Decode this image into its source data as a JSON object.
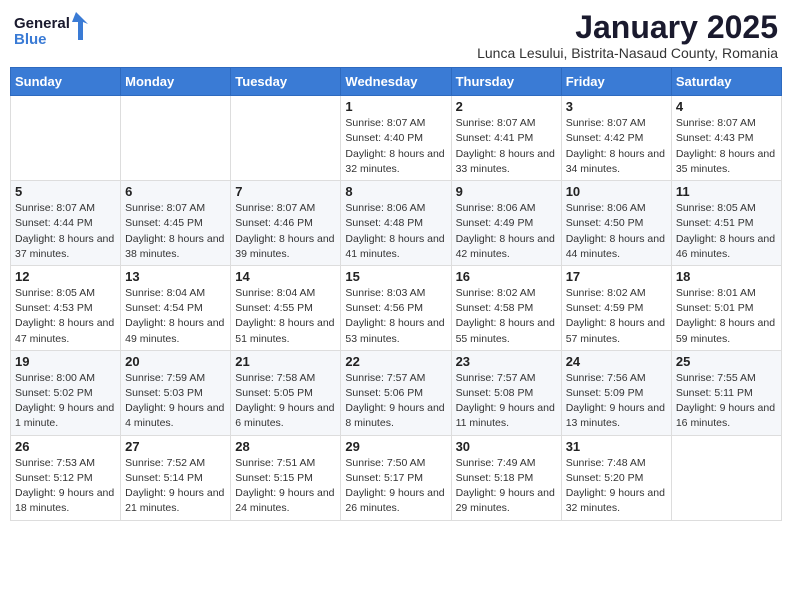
{
  "logo": {
    "general": "General",
    "blue": "Blue",
    "arrow_color": "#3a7bd5"
  },
  "header": {
    "month": "January 2025",
    "location": "Lunca Lesului, Bistrita-Nasaud County, Romania"
  },
  "weekdays": [
    "Sunday",
    "Monday",
    "Tuesday",
    "Wednesday",
    "Thursday",
    "Friday",
    "Saturday"
  ],
  "weeks": [
    [
      {
        "day": "",
        "info": ""
      },
      {
        "day": "",
        "info": ""
      },
      {
        "day": "",
        "info": ""
      },
      {
        "day": "1",
        "info": "Sunrise: 8:07 AM\nSunset: 4:40 PM\nDaylight: 8 hours and 32 minutes."
      },
      {
        "day": "2",
        "info": "Sunrise: 8:07 AM\nSunset: 4:41 PM\nDaylight: 8 hours and 33 minutes."
      },
      {
        "day": "3",
        "info": "Sunrise: 8:07 AM\nSunset: 4:42 PM\nDaylight: 8 hours and 34 minutes."
      },
      {
        "day": "4",
        "info": "Sunrise: 8:07 AM\nSunset: 4:43 PM\nDaylight: 8 hours and 35 minutes."
      }
    ],
    [
      {
        "day": "5",
        "info": "Sunrise: 8:07 AM\nSunset: 4:44 PM\nDaylight: 8 hours and 37 minutes."
      },
      {
        "day": "6",
        "info": "Sunrise: 8:07 AM\nSunset: 4:45 PM\nDaylight: 8 hours and 38 minutes."
      },
      {
        "day": "7",
        "info": "Sunrise: 8:07 AM\nSunset: 4:46 PM\nDaylight: 8 hours and 39 minutes."
      },
      {
        "day": "8",
        "info": "Sunrise: 8:06 AM\nSunset: 4:48 PM\nDaylight: 8 hours and 41 minutes."
      },
      {
        "day": "9",
        "info": "Sunrise: 8:06 AM\nSunset: 4:49 PM\nDaylight: 8 hours and 42 minutes."
      },
      {
        "day": "10",
        "info": "Sunrise: 8:06 AM\nSunset: 4:50 PM\nDaylight: 8 hours and 44 minutes."
      },
      {
        "day": "11",
        "info": "Sunrise: 8:05 AM\nSunset: 4:51 PM\nDaylight: 8 hours and 46 minutes."
      }
    ],
    [
      {
        "day": "12",
        "info": "Sunrise: 8:05 AM\nSunset: 4:53 PM\nDaylight: 8 hours and 47 minutes."
      },
      {
        "day": "13",
        "info": "Sunrise: 8:04 AM\nSunset: 4:54 PM\nDaylight: 8 hours and 49 minutes."
      },
      {
        "day": "14",
        "info": "Sunrise: 8:04 AM\nSunset: 4:55 PM\nDaylight: 8 hours and 51 minutes."
      },
      {
        "day": "15",
        "info": "Sunrise: 8:03 AM\nSunset: 4:56 PM\nDaylight: 8 hours and 53 minutes."
      },
      {
        "day": "16",
        "info": "Sunrise: 8:02 AM\nSunset: 4:58 PM\nDaylight: 8 hours and 55 minutes."
      },
      {
        "day": "17",
        "info": "Sunrise: 8:02 AM\nSunset: 4:59 PM\nDaylight: 8 hours and 57 minutes."
      },
      {
        "day": "18",
        "info": "Sunrise: 8:01 AM\nSunset: 5:01 PM\nDaylight: 8 hours and 59 minutes."
      }
    ],
    [
      {
        "day": "19",
        "info": "Sunrise: 8:00 AM\nSunset: 5:02 PM\nDaylight: 9 hours and 1 minute."
      },
      {
        "day": "20",
        "info": "Sunrise: 7:59 AM\nSunset: 5:03 PM\nDaylight: 9 hours and 4 minutes."
      },
      {
        "day": "21",
        "info": "Sunrise: 7:58 AM\nSunset: 5:05 PM\nDaylight: 9 hours and 6 minutes."
      },
      {
        "day": "22",
        "info": "Sunrise: 7:57 AM\nSunset: 5:06 PM\nDaylight: 9 hours and 8 minutes."
      },
      {
        "day": "23",
        "info": "Sunrise: 7:57 AM\nSunset: 5:08 PM\nDaylight: 9 hours and 11 minutes."
      },
      {
        "day": "24",
        "info": "Sunrise: 7:56 AM\nSunset: 5:09 PM\nDaylight: 9 hours and 13 minutes."
      },
      {
        "day": "25",
        "info": "Sunrise: 7:55 AM\nSunset: 5:11 PM\nDaylight: 9 hours and 16 minutes."
      }
    ],
    [
      {
        "day": "26",
        "info": "Sunrise: 7:53 AM\nSunset: 5:12 PM\nDaylight: 9 hours and 18 minutes."
      },
      {
        "day": "27",
        "info": "Sunrise: 7:52 AM\nSunset: 5:14 PM\nDaylight: 9 hours and 21 minutes."
      },
      {
        "day": "28",
        "info": "Sunrise: 7:51 AM\nSunset: 5:15 PM\nDaylight: 9 hours and 24 minutes."
      },
      {
        "day": "29",
        "info": "Sunrise: 7:50 AM\nSunset: 5:17 PM\nDaylight: 9 hours and 26 minutes."
      },
      {
        "day": "30",
        "info": "Sunrise: 7:49 AM\nSunset: 5:18 PM\nDaylight: 9 hours and 29 minutes."
      },
      {
        "day": "31",
        "info": "Sunrise: 7:48 AM\nSunset: 5:20 PM\nDaylight: 9 hours and 32 minutes."
      },
      {
        "day": "",
        "info": ""
      }
    ]
  ]
}
